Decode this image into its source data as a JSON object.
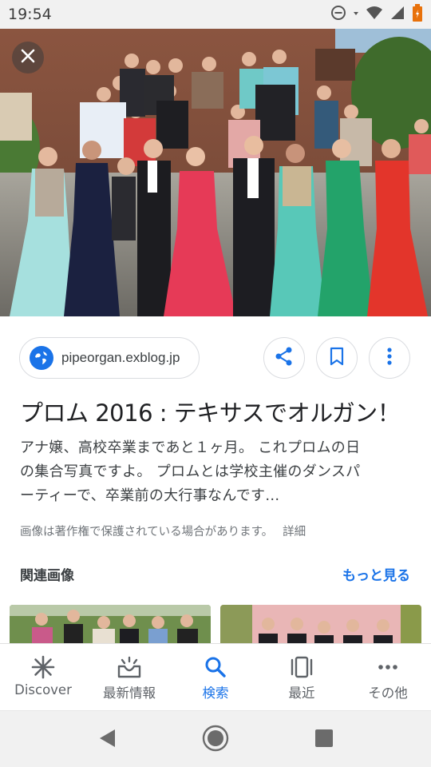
{
  "status_bar": {
    "time": "19:54",
    "icons": [
      "do-not-disturb-icon",
      "wifi-icon",
      "signal-icon",
      "battery-icon"
    ]
  },
  "viewer": {
    "close_icon": "close-icon",
    "source": {
      "site": "pipeorgan.exblog.jp",
      "icon": "globe-icon"
    },
    "actions": [
      "share-icon",
      "bookmark-icon",
      "more-vert-icon"
    ],
    "title": "プロム 2016 : テキサスでオルガン！",
    "description_lines": [
      "アナ嬢、高校卒業まであと１ヶ月。 これプロムの日",
      "の集合写真ですよ。 プロムとは学校主催のダンスパ",
      "ーティーで、卒業前の大行事なんです..."
    ],
    "copyright_notice": "画像は著作権で保護されている場合があります。",
    "detail_link": "詳細"
  },
  "related": {
    "heading": "関連画像",
    "more_label": "もっと見る"
  },
  "bottom_nav": {
    "items": [
      {
        "label": "Discover",
        "icon": "asterisk-icon",
        "active": false
      },
      {
        "label": "最新情報",
        "icon": "updates-tray-icon",
        "active": false
      },
      {
        "label": "検索",
        "icon": "search-icon",
        "active": true
      },
      {
        "label": "最近",
        "icon": "recent-cards-icon",
        "active": false
      },
      {
        "label": "その他",
        "icon": "more-horiz-icon",
        "active": false
      }
    ]
  },
  "system_nav": [
    "back-icon",
    "home-icon",
    "overview-icon"
  ],
  "colors": {
    "accent": "#1a73e8",
    "text_primary": "#202124",
    "text_secondary": "#3c4043",
    "text_muted": "#70757a",
    "status_bar_bg": "#f1f1f1",
    "battery": "#e8710a"
  }
}
